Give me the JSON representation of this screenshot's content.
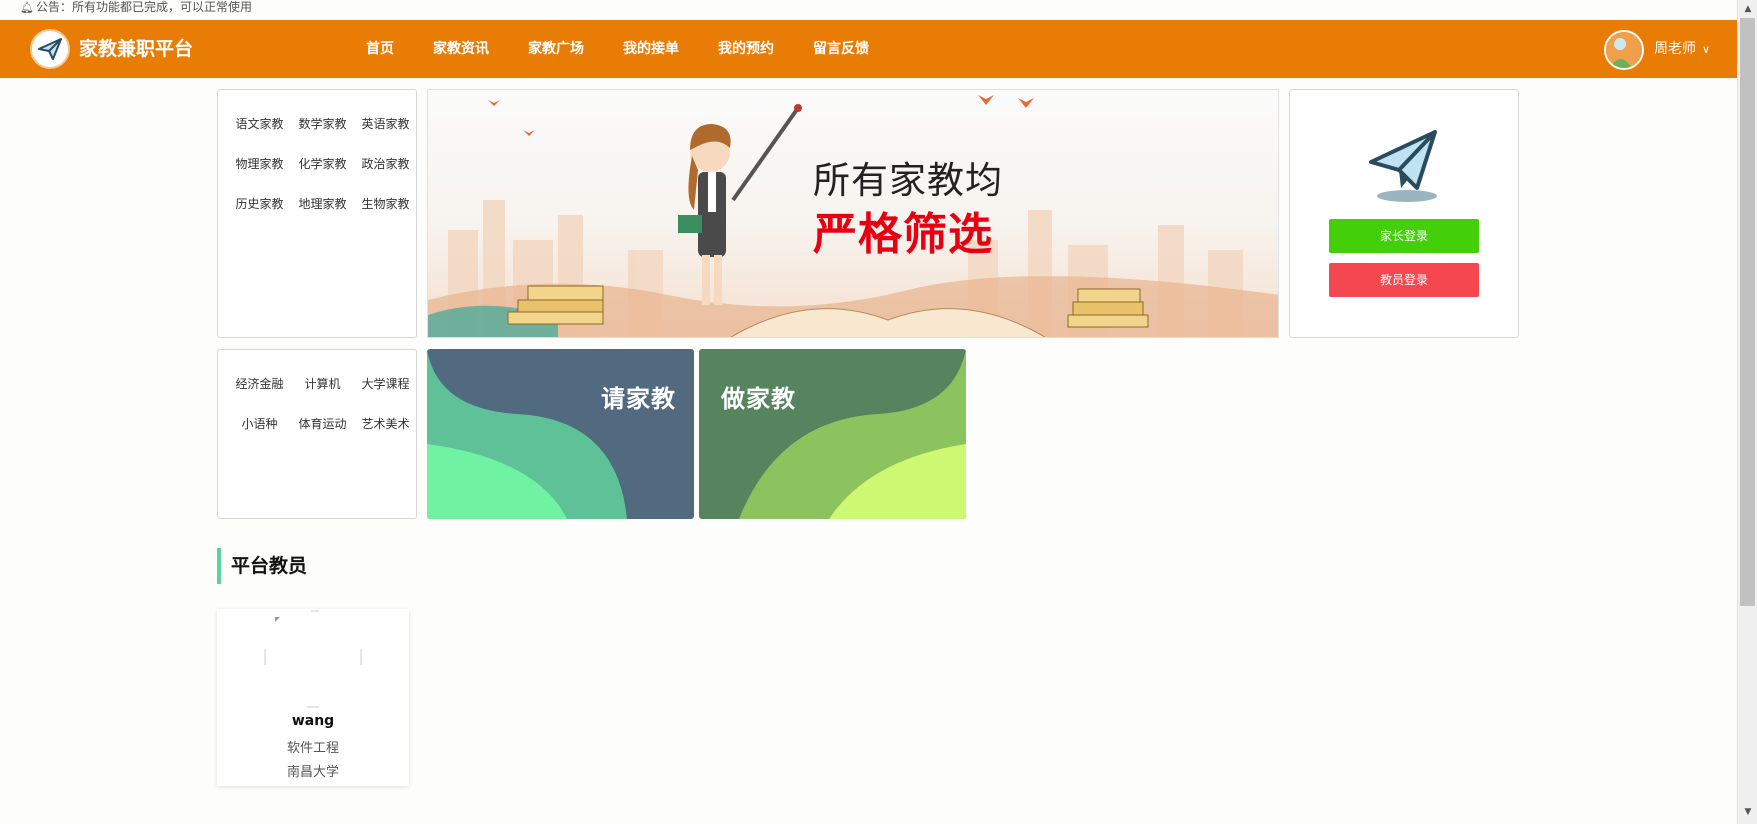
{
  "notice": {
    "icon": "bell-icon",
    "text": "公告：所有功能都已完成，可以正常使用"
  },
  "header": {
    "brand": "家教兼职平台",
    "logo_icon": "paper-plane-icon",
    "nav": [
      {
        "label": "首页"
      },
      {
        "label": "家教资讯"
      },
      {
        "label": "家教广场"
      },
      {
        "label": "我的接单"
      },
      {
        "label": "我的预约"
      },
      {
        "label": "留言反馈"
      }
    ],
    "user": {
      "name": "周老师",
      "avatar_icon": "avatar-icon",
      "chevron_icon": "chevron-down-icon"
    },
    "color": "#e87c05"
  },
  "categories_primary": [
    "语文家教",
    "数学家教",
    "英语家教",
    "物理家教",
    "化学家教",
    "政治家教",
    "历史家教",
    "地理家教",
    "生物家教"
  ],
  "categories_secondary": [
    "经济金融",
    "计算机",
    "大学课程",
    "小语种",
    "体育运动",
    "艺术美术"
  ],
  "banner": {
    "line1": "所有家教均",
    "line2": "严格筛选"
  },
  "login": {
    "icon": "paper-plane-icon",
    "parent_button": "家长登录",
    "teacher_button": "教员登录",
    "parent_color": "#44cf0b",
    "teacher_color": "#f5474f"
  },
  "tiles": {
    "request": "请家教",
    "become": "做家教"
  },
  "section": {
    "title": "平台教员",
    "accent": "#5bd49c"
  },
  "teachers": [
    {
      "name": "wang",
      "major": "软件工程",
      "school": "南昌大学"
    }
  ]
}
